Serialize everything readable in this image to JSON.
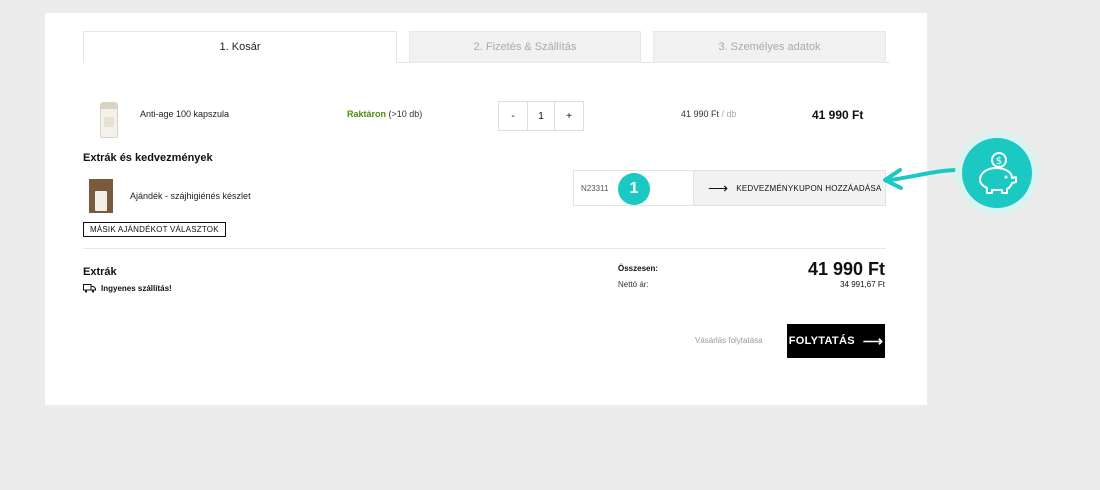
{
  "tabs": [
    "1. Kosár",
    "2. Fizetés & Szállítás",
    "3. Személyes adatok"
  ],
  "product": {
    "name": "Anti-age 100 kapszula",
    "stock_label": "Raktáron",
    "stock_count": "(>10 db)",
    "qty_minus": "-",
    "qty": "1",
    "qty_plus": "+",
    "unit_price": "41 990 Ft",
    "unit_suffix": "/ db",
    "total": "41 990 Ft"
  },
  "extras": {
    "title": "Extrák és kedvezmények",
    "gift_name": "Ajándék - szájhigiénés készlet",
    "gift_button": "MÁSIK AJÁNDÉKOT VÁLASZTOK"
  },
  "coupon": {
    "value": "N23311",
    "badge": "1",
    "button_arrow": "⟶",
    "button_label": "KEDVEZMÉNYKUPON HOZZÁADÁSA"
  },
  "summary": {
    "extras_title": "Extrák",
    "free_shipping": "Ingyenes szállítás!",
    "total_label": "Összesen:",
    "net_label": "Nettó ár:",
    "total": "41 990 Ft",
    "net": "34 991,67 Ft"
  },
  "actions": {
    "continue_shopping": "Vásárlás folytatása",
    "proceed": "FOLYTATÁS",
    "proceed_arrow": "⟶"
  },
  "colors": {
    "accent": "#1cc9c2",
    "stock_green": "#4f8a10",
    "cta_bg": "#000000"
  },
  "icons": {
    "shipping": "truck-icon",
    "annotation": "piggy-bank-coin-icon"
  }
}
